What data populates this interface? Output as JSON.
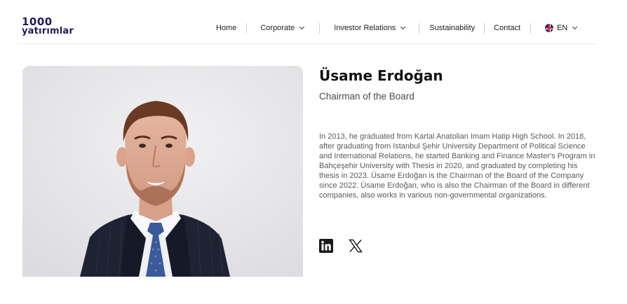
{
  "header": {
    "logo": {
      "number": "1000",
      "word": "yatırımlar"
    },
    "nav": [
      {
        "label": "Home"
      },
      {
        "label": "Corporate"
      },
      {
        "label": "Investor Relations"
      },
      {
        "label": "Sustainability"
      },
      {
        "label": "Contact"
      }
    ],
    "language": "EN"
  },
  "profile": {
    "name": "Üsame Erdoğan",
    "title": "Chairman of the Board",
    "bio": "In 2013, he graduated from Kartal Anatolian Imam Hatip High School. In 2018, after graduating from Istanbul Şehir University Department of Political Science and International Relations, he started Banking and Finance Master's Program in Bahçeşehir University with Thesis in 2020, and graduated by completing his thesis in 2023. Üsame Erdoğan is the Chairman of the Board of the Company since 2022. Üsame Erdoğan, who is also the Chairman of the Board in different companies, also works in various non-governmental organizations."
  },
  "socials": [
    {
      "icon": "linkedin-icon"
    },
    {
      "icon": "x-icon"
    }
  ],
  "colors": {
    "brand": "#221a58",
    "text": "#1b1b1b",
    "muted": "#5a5a5a",
    "divider": "#cfcfcf",
    "photo_background": "#e7e7e9",
    "suit": "#1f2233",
    "tie": "#3a5a9a"
  }
}
